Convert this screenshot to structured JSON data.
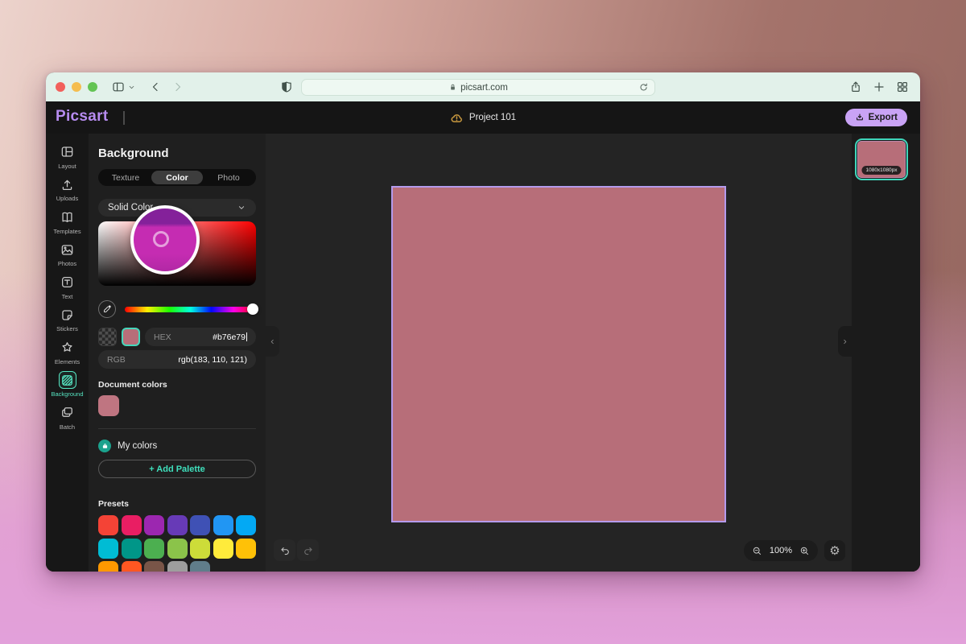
{
  "browser": {
    "url": "picsart.com"
  },
  "app_header": {
    "logo": "Picsart",
    "project_name": "Project 101",
    "export_label": "Export"
  },
  "rail": {
    "active": "Background",
    "items": [
      {
        "id": "layout",
        "label": "Layout",
        "icon": "layout-icon"
      },
      {
        "id": "uploads",
        "label": "Uploads",
        "icon": "upload-icon"
      },
      {
        "id": "templates",
        "label": "Templates",
        "icon": "templates-icon"
      },
      {
        "id": "photos",
        "label": "Photos",
        "icon": "photos-icon"
      },
      {
        "id": "text",
        "label": "Text",
        "icon": "text-icon"
      },
      {
        "id": "stickers",
        "label": "Stickers",
        "icon": "sticker-icon"
      },
      {
        "id": "elements",
        "label": "Elements",
        "icon": "star-icon"
      },
      {
        "id": "background",
        "label": "Background",
        "icon": "background-icon"
      },
      {
        "id": "batch",
        "label": "Batch",
        "icon": "batch-icon"
      }
    ]
  },
  "panel": {
    "title": "Background",
    "tabs": [
      {
        "label": "Texture",
        "active": false
      },
      {
        "label": "Color",
        "active": true
      },
      {
        "label": "Photo",
        "active": false
      }
    ],
    "fill_type": "Solid Color",
    "hex": {
      "label": "HEX",
      "value": "#b76e79"
    },
    "rgb": {
      "label": "RGB",
      "value": "rgb(183, 110, 121)"
    },
    "document_colors": {
      "label": "Document colors",
      "swatches": [
        "#bf7581"
      ]
    },
    "my_colors_label": "My colors",
    "add_palette_label": "+ Add Palette",
    "presets_label": "Presets",
    "presets": [
      "#f44336",
      "#e91e63",
      "#9c27b0",
      "#673ab7",
      "#3f51b5",
      "#2196f3",
      "#03a9f4",
      "#00bcd4",
      "#009688",
      "#4caf50",
      "#8bc34a",
      "#cddc39",
      "#ffeb3b",
      "#ffc107",
      "#ff9800",
      "#ff5722",
      "#795548",
      "#9e9e9e",
      "#607d8b"
    ]
  },
  "canvas": {
    "artboard_color": "#b76e79",
    "zoom": "100%"
  },
  "right_panel": {
    "page_size_label": "1080x1080px"
  },
  "colors": {
    "brand_purple": "#b78cf0",
    "export_button": "#c9a3f5",
    "accent_teal": "#3fe0bd",
    "selection_purple": "#b49aec",
    "loupe_color": "#c52cb2",
    "loupe_top": "#84219a"
  }
}
